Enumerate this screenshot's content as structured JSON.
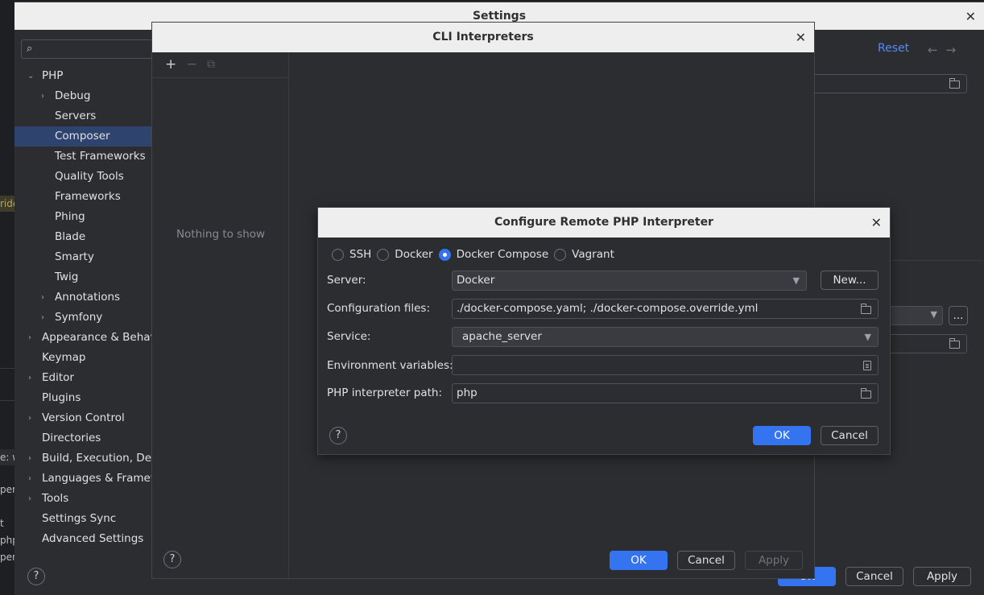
{
  "behind": {
    "fragment_1": "ride",
    "fragment_2": "e: w",
    "fragment_3": "per",
    "fragment_4": "t",
    "fragment_5": "php",
    "fragment_6": "per"
  },
  "settings": {
    "title": "Settings",
    "reset_label": "Reset",
    "search_placeholder": "",
    "tree": [
      {
        "label": "PHP",
        "expanded": true
      },
      {
        "label": "Debug",
        "collapsed": true
      },
      {
        "label": "Servers"
      },
      {
        "label": "Composer",
        "selected": true
      },
      {
        "label": "Test Frameworks"
      },
      {
        "label": "Quality Tools"
      },
      {
        "label": "Frameworks"
      },
      {
        "label": "Phing"
      },
      {
        "label": "Blade"
      },
      {
        "label": "Smarty"
      },
      {
        "label": "Twig"
      },
      {
        "label": "Annotations",
        "collapsed": true
      },
      {
        "label": "Symfony",
        "collapsed": true
      },
      {
        "label": "Appearance & Behavior",
        "collapsed": true
      },
      {
        "label": "Keymap"
      },
      {
        "label": "Editor",
        "collapsed": true
      },
      {
        "label": "Plugins"
      },
      {
        "label": "Version Control",
        "collapsed": true
      },
      {
        "label": "Directories"
      },
      {
        "label": "Build, Execution, Deployment",
        "collapsed": true
      },
      {
        "label": "Languages & Frameworks",
        "collapsed": true
      },
      {
        "label": "Tools",
        "collapsed": true
      },
      {
        "label": "Settings Sync"
      },
      {
        "label": "Advanced Settings"
      }
    ],
    "buttons": {
      "ok": "OK",
      "cancel": "Cancel",
      "apply": "Apply"
    },
    "more_button": "..."
  },
  "cli": {
    "title": "CLI Interpreters",
    "empty_text": "Nothing to show",
    "toolbar": {
      "add": "+",
      "remove": "−",
      "copy": "⧉"
    },
    "buttons": {
      "ok": "OK",
      "cancel": "Cancel",
      "apply": "Apply"
    }
  },
  "remote": {
    "title": "Configure Remote PHP Interpreter",
    "radios": [
      {
        "label": "SSH",
        "checked": false
      },
      {
        "label": "Docker",
        "checked": false
      },
      {
        "label": "Docker Compose",
        "checked": true
      },
      {
        "label": "Vagrant",
        "checked": false
      }
    ],
    "server_label": "Server:",
    "server_value": "Docker",
    "new_button": "New...",
    "config_label": "Configuration files:",
    "config_value": "./docker-compose.yaml; ./docker-compose.override.yml",
    "service_label": "Service:",
    "service_value": "apache_server",
    "env_label": "Environment variables:",
    "env_value": "",
    "php_path_label": "PHP interpreter path:",
    "php_path_value": "php",
    "buttons": {
      "ok": "OK",
      "cancel": "Cancel"
    },
    "help": "?"
  },
  "colors": {
    "accent": "#3574f0",
    "selection": "#2e436e",
    "link": "#548af7"
  }
}
